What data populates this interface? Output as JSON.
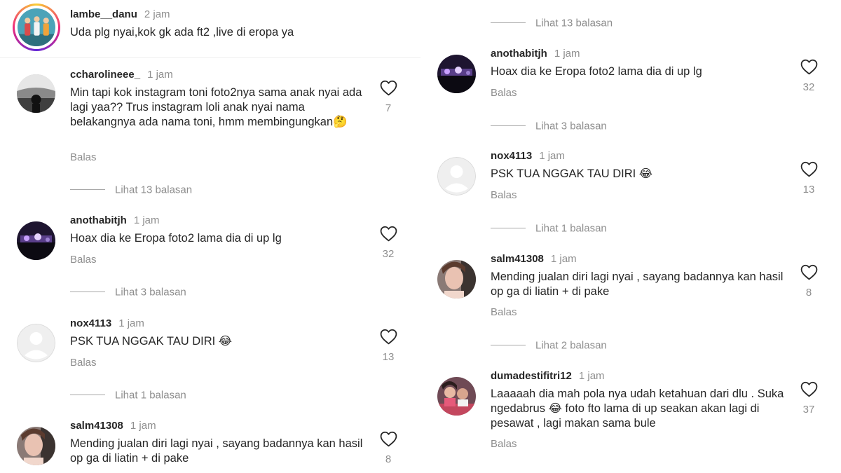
{
  "header_comment": {
    "username": "lambe__danu",
    "time": "2 jam",
    "text": "Uda plg nyai,kok gk ada ft2 ,live di eropa ya"
  },
  "left_comments": [
    {
      "username": "ccharolineee_",
      "time": "1 jam",
      "text": "Min tapi kok instagram toni foto2nya sama anak nyai ada lagi yaa?? Trus instagram loli anak nyai nama belakangnya ada nama toni, hmm membingungkan🤔",
      "reply": "Balas",
      "likes": "7",
      "view_replies": "Lihat 13 balasan"
    },
    {
      "username": "anothabitjh",
      "time": "1 jam",
      "text": "Hoax dia ke Eropa foto2 lama dia di up lg",
      "reply": "Balas",
      "likes": "32",
      "view_replies": "Lihat 3 balasan"
    },
    {
      "username": "nox4113",
      "time": "1 jam",
      "text": "PSK TUA NGGAK TAU DIRI 😂",
      "reply": "Balas",
      "likes": "13",
      "view_replies": "Lihat 1 balasan"
    },
    {
      "username": "salm41308",
      "time": "1 jam",
      "text": "Mending jualan diri lagi nyai , sayang badannya kan hasil op ga di liatin + di pake",
      "likes": "8"
    }
  ],
  "right_top_view_replies": "Lihat 13 balasan",
  "right_comments": [
    {
      "username": "anothabitjh",
      "time": "1 jam",
      "text": "Hoax dia ke Eropa foto2 lama dia di up lg",
      "reply": "Balas",
      "likes": "32",
      "view_replies": "Lihat 3 balasan"
    },
    {
      "username": "nox4113",
      "time": "1 jam",
      "text": "PSK TUA NGGAK TAU DIRI 😂",
      "reply": "Balas",
      "likes": "13",
      "view_replies": "Lihat 1 balasan"
    },
    {
      "username": "salm41308",
      "time": "1 jam",
      "text": "Mending jualan diri lagi nyai , sayang badannya kan hasil op ga di liatin + di pake",
      "reply": "Balas",
      "likes": "8",
      "view_replies": "Lihat 2 balasan"
    },
    {
      "username": "dumadestifitri12",
      "time": "1 jam",
      "text": "Laaaaah dia mah pola nya udah ketahuan dari dlu . Suka ngedabrus 😂 foto fto lama di up seakan akan lagi di pesawat , lagi makan sama bule",
      "reply": "Balas",
      "likes": "37"
    }
  ],
  "icons": {
    "like": "heart-outline-icon",
    "default_avatar": "default-avatar-icon"
  },
  "colors": {
    "text": "#262626",
    "muted": "#8e8e8e",
    "line": "#a8a8a8"
  }
}
